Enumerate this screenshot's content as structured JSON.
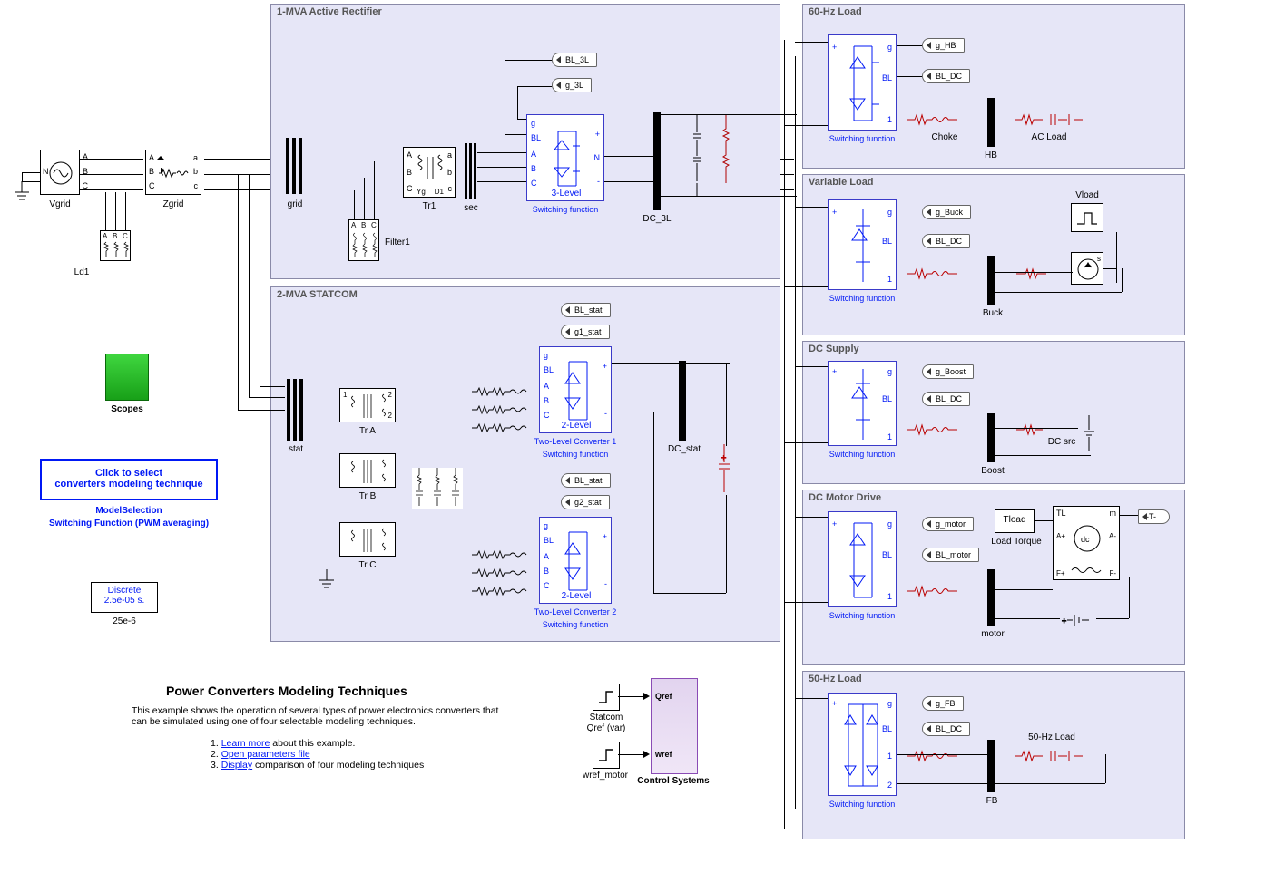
{
  "title": "Power Converters Modeling Techniques",
  "description": "This example shows the operation of several types of power electronics converters that can be simulated using one of four selectable modeling techniques.",
  "links": {
    "learn": "Learn more",
    "learn_suffix": " about this example.",
    "open": "Open parameters file",
    "display": "Display",
    "display_suffix": " comparison of four modeling techniques"
  },
  "grid": {
    "vgrid": "Vgrid",
    "zgrid": "Zgrid",
    "ld1": "Ld1",
    "ports": {
      "a": "A",
      "b": "B",
      "c": "C",
      "n": "N",
      "a2": "a",
      "b2": "b",
      "c2": "c"
    }
  },
  "scopes": {
    "label": "Scopes"
  },
  "select_btn": {
    "line1": "Click to select",
    "line2": "converters modeling technique"
  },
  "model_sel": {
    "title": "ModelSelection",
    "mode": "Switching Function (PWM averaging)"
  },
  "powergui": {
    "line1": "Discrete",
    "line2": "2.5e-05 s.",
    "below": "25e-6"
  },
  "rect": {
    "title": "1-MVA Active Rectifier",
    "grid": "grid",
    "tr1": "Tr1",
    "sec": "sec",
    "filter": "Filter1",
    "conv": "3-Level",
    "sf": "Switching function",
    "dc": "DC_3L",
    "tag_bl": "BL_3L",
    "tag_g": "g_3L",
    "ports": {
      "g": "g",
      "bl": "BL",
      "a": "A",
      "b": "B",
      "c": "C",
      "p": "+",
      "n": "N",
      "m": "-",
      "plus": "+"
    }
  },
  "statcom": {
    "title": "2-MVA STATCOM",
    "stat": "stat",
    "tra": "Tr A",
    "trb": "Tr B",
    "trc": "Tr C",
    "conv1": "2-Level",
    "conv1name": "Two-Level Converter 1",
    "sf": "Switching function",
    "conv2": "2-Level",
    "conv2name": "Two-Level Converter 2",
    "dc": "DC_stat",
    "tag_bl": "BL_stat",
    "tag_g1": "g1_stat",
    "tag_g2": "g2_stat"
  },
  "load60": {
    "title": "60-Hz Load",
    "sf": "Switching function",
    "tag_g": "g_HB",
    "tag_bl": "BL_DC",
    "choke": "Choke",
    "acload": "AC Load",
    "bus": "HB",
    "ports": {
      "g": "g",
      "bl": "BL",
      "one": "1",
      "plus": "+"
    }
  },
  "varload": {
    "title": "Variable Load",
    "sf": "Switching function",
    "tag_g": "g_Buck",
    "tag_bl": "BL_DC",
    "vload": "Vload",
    "bus": "Buck"
  },
  "dcsupply": {
    "title": "DC Supply",
    "sf": "Switching function",
    "tag_g": "g_Boost",
    "tag_bl": "BL_DC",
    "dcsrc": "DC src",
    "bus": "Boost"
  },
  "dcmotor": {
    "title": "DC Motor Drive",
    "sf": "Switching function",
    "tag_g": "g_motor",
    "tag_bl": "BL_motor",
    "tload": "Tload",
    "loadtorque": "Load Torque",
    "tag_t": "-T-",
    "bus": "motor",
    "ports": {
      "tl": "TL",
      "m": "m",
      "ap": "A+",
      "am": "A-",
      "fp": "F+",
      "fm": "F-",
      "dc": "dc"
    }
  },
  "load50": {
    "title": "50-Hz Load",
    "sf": "Switching function",
    "tag_g": "g_FB",
    "tag_bl": "BL_DC",
    "acload": "50-Hz Load",
    "bus": "FB",
    "ports": {
      "one": "1",
      "two": "2"
    }
  },
  "ctrl": {
    "title": "Control Systems",
    "statcom": "Statcom",
    "qrefvar": "Qref (var)",
    "qref": "Qref",
    "wrefmotor": "wref_motor",
    "wref": "wref"
  }
}
